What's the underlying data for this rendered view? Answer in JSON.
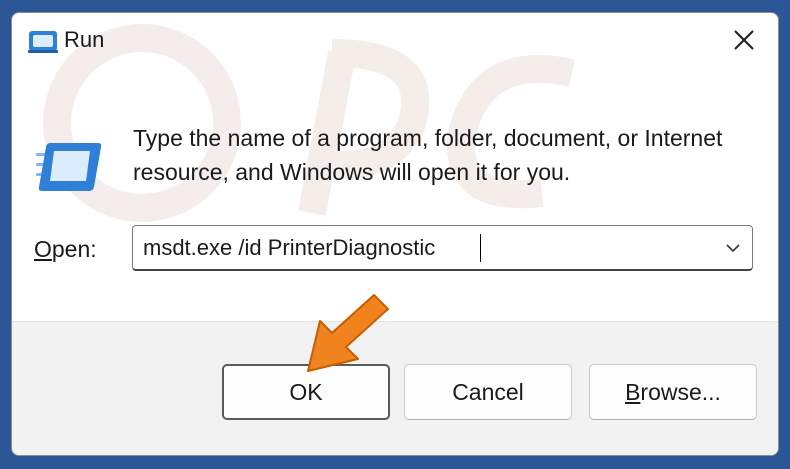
{
  "window": {
    "title": "Run",
    "icon": "run-icon",
    "close_icon": "close-icon"
  },
  "main": {
    "description": "Type the name of a program, folder, document, or Internet resource, and Windows will open it for you.",
    "open_label_mnemonic": "O",
    "open_label_rest": "pen:",
    "open_value": "msdt.exe /id PrinterDiagnostic",
    "dropdown_icon": "chevron-down-icon"
  },
  "buttons": {
    "ok": "OK",
    "cancel": "Cancel",
    "browse_mnemonic": "B",
    "browse_rest": "rowse..."
  },
  "colors": {
    "background": "#2b5797",
    "arrow": "#f0831e",
    "footer": "#f2f2f2",
    "icon_blue": "#2f7fd6"
  }
}
